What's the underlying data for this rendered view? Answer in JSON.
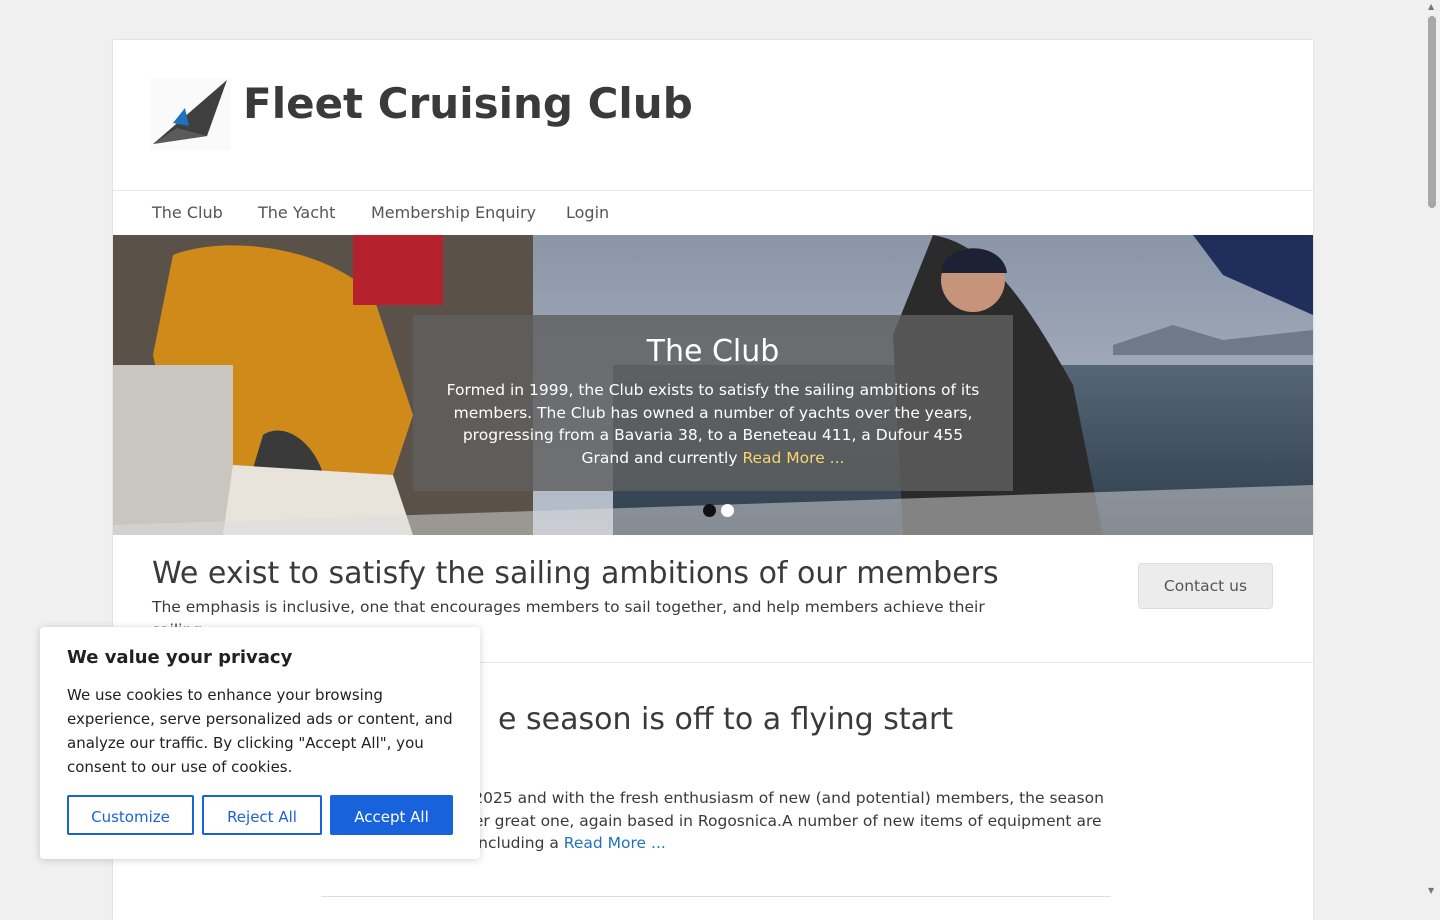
{
  "site": {
    "title": "Fleet Cruising Club",
    "logo_icon": "sail-logo-icon"
  },
  "nav": {
    "items": [
      "The Club",
      "The Yacht",
      "Membership Enquiry",
      "Login"
    ]
  },
  "hero": {
    "caption_title": "The Club",
    "caption_text": "Formed in 1999, the Club exists to satisfy the sailing ambitions of its members. The Club has owned a number of yachts over the years, progressing from a Bavaria 38, to a Beneteau 411, a Dufour 455 Grand and currently ",
    "caption_link": "Read More ...",
    "slides_total": 2,
    "active_slide": 1,
    "link_color": "#f5d76e"
  },
  "intro": {
    "title": "We exist to satisfy the sailing ambitions of our members",
    "text": "The emphasis is inclusive, one that encourages members to sail together, and help members achieve their sailing",
    "contact_button": "Contact us"
  },
  "post": {
    "title_fragment": "e season is off to a flying start",
    "line1": "l 2025 and with the fresh enthusiasm of new (and potential) members, the season",
    "line2": "her great one, again based in Rogosnica.A number of new items of equipment are",
    "line3": ", including a ",
    "read_more": "Read More ...",
    "link_color": "#1e73be"
  },
  "cookie": {
    "title": "We value your privacy",
    "text": "We use cookies to enhance your browsing experience, serve personalized ads or content, and analyze our traffic. By clicking \"Accept All\", you consent to our use of cookies.",
    "customize": "Customize",
    "reject": "Reject All",
    "accept": "Accept All",
    "accent_color": "#1863dc"
  }
}
